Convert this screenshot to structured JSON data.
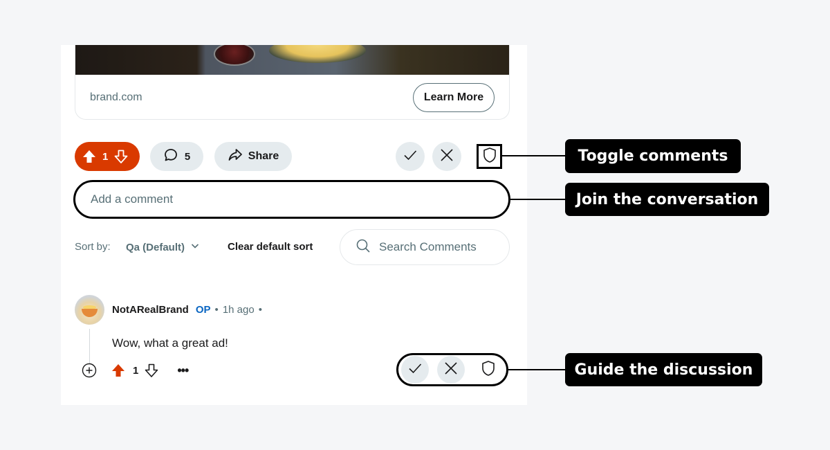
{
  "ad": {
    "domain": "brand.com",
    "cta_label": "Learn More"
  },
  "post_actions": {
    "vote_count": "1",
    "comment_count": "5",
    "share_label": "Share"
  },
  "comment_input": {
    "placeholder": "Add a comment"
  },
  "sort": {
    "label": "Sort by:",
    "value": "Qa (Default)",
    "clear_label": "Clear default sort"
  },
  "search": {
    "placeholder": "Search Comments"
  },
  "comment": {
    "author": "NotARealBrand",
    "op_badge": "OP",
    "separator": "•",
    "time": "1h ago",
    "text": "Wow, what a great ad!",
    "score": "1",
    "more": "•••"
  },
  "callouts": {
    "toggle_comments": "Toggle comments",
    "join_conversation": "Join the conversation",
    "guide_discussion": "Guide the discussion"
  },
  "colors": {
    "upvote_orange": "#d93a00",
    "pill_gray": "#e5ebee",
    "muted_text": "#576f76",
    "op_blue": "#0a66c2",
    "callout_black": "#000000"
  },
  "icons": {
    "upvote": "arrow-up-icon",
    "downvote": "arrow-down-icon",
    "comment": "speech-bubble-icon",
    "share": "share-arrow-icon",
    "approve": "checkmark-icon",
    "remove": "x-icon",
    "mod": "shield-icon",
    "search": "search-icon",
    "expand": "plus-circle-icon",
    "chevron": "chevron-down-icon"
  }
}
